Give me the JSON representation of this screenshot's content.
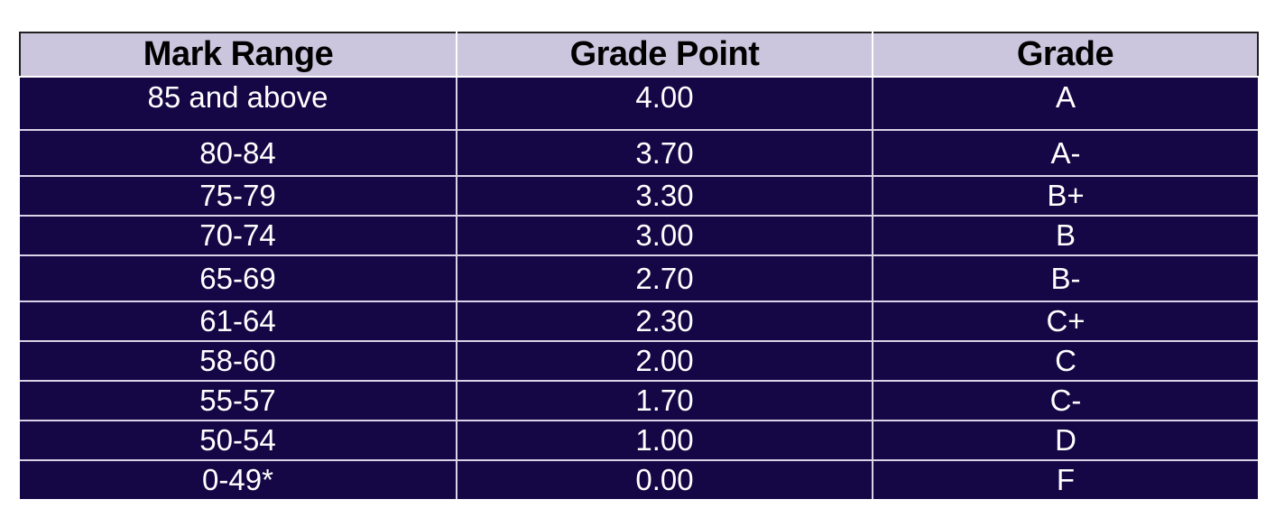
{
  "table": {
    "headers": [
      "Mark Range",
      "Grade Point",
      "Grade"
    ],
    "rows": [
      [
        "85 and above",
        "4.00",
        "A"
      ],
      [
        "80-84",
        "3.70",
        "A-"
      ],
      [
        "75-79",
        "3.30",
        "B+"
      ],
      [
        "70-74",
        "3.00",
        "B"
      ],
      [
        "65-69",
        "2.70",
        "B-"
      ],
      [
        "61-64",
        "2.30",
        "C+"
      ],
      [
        "58-60",
        "2.00",
        "C"
      ],
      [
        "55-57",
        "1.70",
        "C-"
      ],
      [
        "50-54",
        "1.00",
        "D"
      ],
      [
        "0-49*",
        "0.00",
        "F"
      ]
    ]
  },
  "colors": {
    "header_background": "#cbc5dd",
    "body_background": "#150745",
    "body_text": "#ffffff",
    "header_text": "#000000"
  }
}
